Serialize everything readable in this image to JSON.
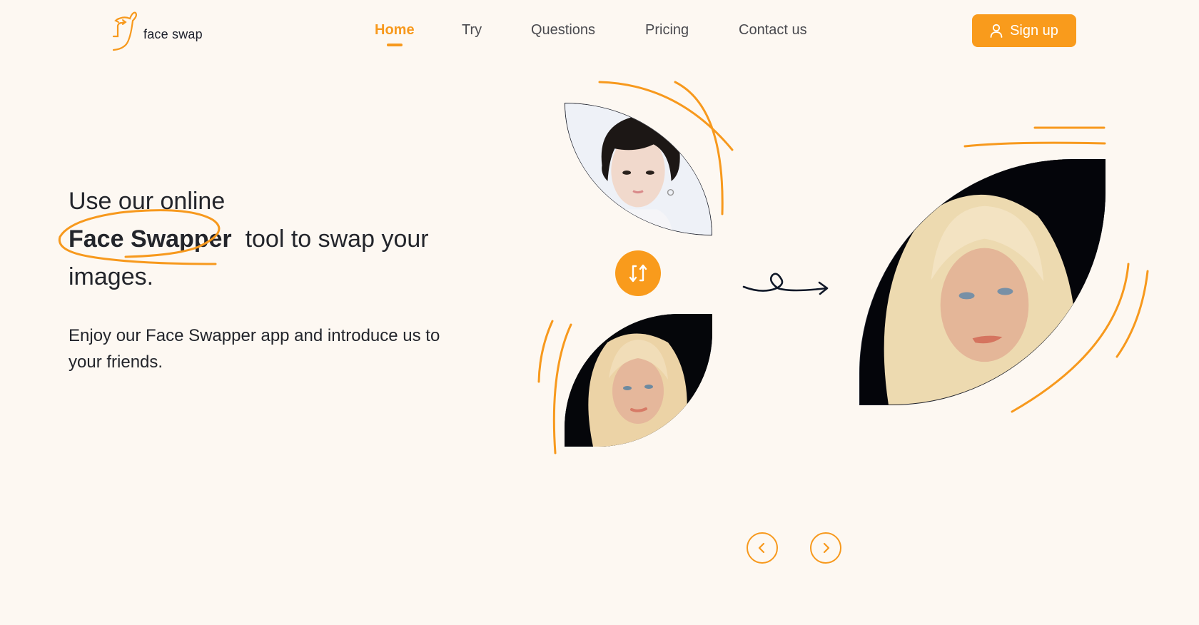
{
  "brand": {
    "name": "face swap",
    "logo_icon": "face-swap-logo-icon",
    "accent": "#f99b1c"
  },
  "nav": {
    "items": [
      {
        "label": "Home",
        "active": true
      },
      {
        "label": "Try",
        "active": false
      },
      {
        "label": "Questions",
        "active": false
      },
      {
        "label": "Pricing",
        "active": false
      },
      {
        "label": "Contact us",
        "active": false
      }
    ],
    "signup_label": "Sign up",
    "signup_icon": "user-icon"
  },
  "hero": {
    "heading_line1": "Use our online",
    "heading_highlight": "Face Swapper",
    "heading_line2_rest": "tool to swap your",
    "heading_line3": "images.",
    "description": "Enjoy our Face Swapper app and introduce us to your friends."
  },
  "showcase": {
    "source_image_alt": "Source face photo (young man with dark hair)",
    "target_image_alt": "Target face photo (woman with blonde hair)",
    "result_image_alt": "Swapped result photo (woman with blonde hair)",
    "swap_icon": "swap-arrows-icon",
    "flow_icon": "curly-arrow-icon",
    "prev_icon": "chevron-left-icon",
    "next_icon": "chevron-right-icon"
  },
  "colors": {
    "background": "#fdf8f2",
    "accent": "#f99b1c",
    "text": "#23252b",
    "nav_text": "#4a4a4f"
  }
}
